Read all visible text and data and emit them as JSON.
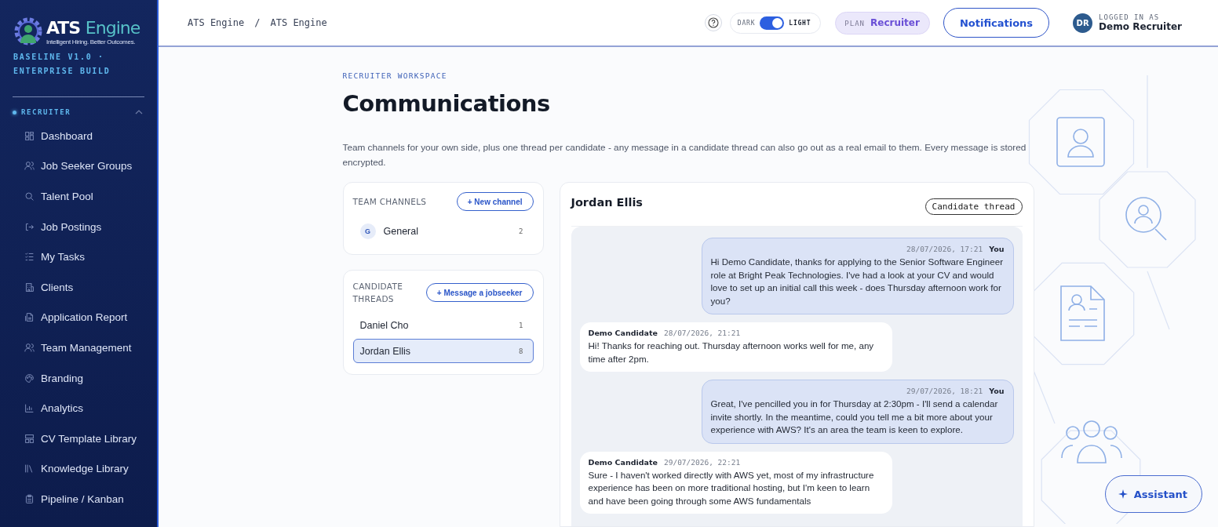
{
  "sidebar": {
    "logo": {
      "primary": "ATS",
      "secondary": "Engine",
      "tagline": "Intelligent Hiring. Better Outcomes."
    },
    "build": "BASELINE V1.0 · ENTERPRISE BUILD",
    "section": {
      "label": "RECRUITER",
      "expanded": true
    },
    "items": [
      {
        "label": "Dashboard"
      },
      {
        "label": "Job Seeker Groups"
      },
      {
        "label": "Talent Pool"
      },
      {
        "label": "Job Postings"
      },
      {
        "label": "My Tasks"
      },
      {
        "label": "Clients"
      },
      {
        "label": "Application Report"
      },
      {
        "label": "Team Management"
      },
      {
        "label": "Branding"
      },
      {
        "label": "Analytics"
      },
      {
        "label": "CV Template Library"
      },
      {
        "label": "Knowledge Library"
      },
      {
        "label": "Pipeline / Kanban"
      }
    ]
  },
  "topbar": {
    "breadcrumbs": [
      "ATS Engine",
      "ATS Engine"
    ],
    "separator": "/",
    "theme_toggle": {
      "left_label": "DARK",
      "right_label": "LIGHT",
      "on": true
    },
    "plan": {
      "label": "PLAN",
      "value": "Recruiter"
    },
    "notifications_button": "Notifications",
    "user": {
      "initials": "DR",
      "caption": "LOGGED IN AS",
      "name": "Demo Recruiter"
    }
  },
  "page": {
    "eyebrow": "RECRUITER WORKSPACE",
    "title": "Communications",
    "description": "Team channels for your own side, plus one thread per candidate - any message in a candidate thread can also go out as a real email to them. Every message is stored encrypted."
  },
  "team_channels": {
    "title": "TEAM CHANNELS",
    "button": "+ New channel",
    "items": [
      {
        "avatar": "G",
        "name": "General",
        "count": "2",
        "selected": false
      }
    ]
  },
  "candidate_threads": {
    "title": "CANDIDATE THREADS",
    "button": "+ Message a jobseeker",
    "items": [
      {
        "name": "Daniel Cho",
        "count": "1",
        "selected": false
      },
      {
        "name": "Jordan Ellis",
        "count": "8",
        "selected": true
      }
    ]
  },
  "conversation": {
    "title": "Jordan Ellis",
    "tag": "Candidate thread",
    "messages": [
      {
        "kind": "outgoing",
        "sender": "You",
        "time": "28/07/2026, 17:21",
        "text": "Hi Demo Candidate, thanks for applying to the Senior Software Engineer role at Bright Peak Technologies. I've had a look at your CV and would love to set up an initial call this week - does Thursday afternoon work for you?"
      },
      {
        "kind": "incoming",
        "sender": "Demo Candidate",
        "time": "28/07/2026, 21:21",
        "text": "Hi! Thanks for reaching out. Thursday afternoon works well for me, any time after 2pm."
      },
      {
        "kind": "outgoing",
        "sender": "You",
        "time": "29/07/2026, 18:21",
        "text": "Great, I've pencilled you in for Thursday at 2:30pm - I'll send a calendar invite shortly. In the meantime, could you tell me a bit more about your experience with AWS? It's an area the team is keen to explore."
      },
      {
        "kind": "incoming",
        "sender": "Demo Candidate",
        "time": "29/07/2026, 22:21",
        "text": "Sure - I haven't worked directly with AWS yet, most of my infrastructure experience has been on more traditional hosting, but I'm keen to learn and have been going through some AWS fundamentals"
      }
    ]
  },
  "assistant_button": "Assistant"
}
